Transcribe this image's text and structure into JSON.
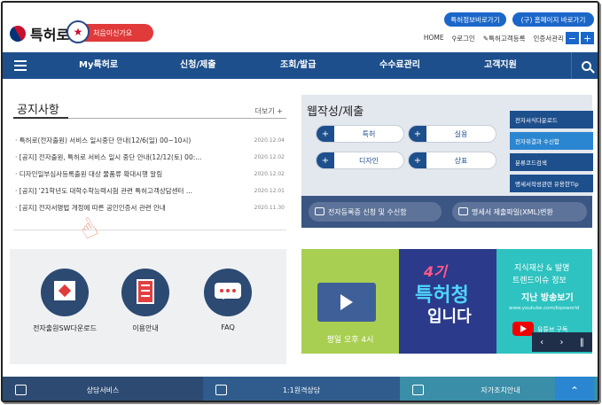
{
  "header": {
    "logo_text": "특허로",
    "first_visit": "처음이신가요",
    "pill_1": "특허정보바로가기",
    "pill_2": "(구) 홈페이지 바로가기",
    "util_links": [
      "HOME",
      "로그인",
      "특허고객등록",
      "인증서관리"
    ],
    "zoom_out": "−",
    "zoom_in": "+"
  },
  "nav": {
    "items": [
      "My특허로",
      "신청/제출",
      "조회/발급",
      "수수료관리",
      "고객지원"
    ]
  },
  "notice": {
    "title": "공지사항",
    "more": "더보기 +",
    "items": [
      {
        "text": "· 특허로(전자출원) 서비스 일시중단 안내(12/6(일) 00~10시)",
        "date": "2020.12.04"
      },
      {
        "text": "· [공지] 전자출원, 특허로 서비스 일시 중단 안내(12/12(토) 00:...",
        "date": "2020.12.02"
      },
      {
        "text": "· 디자인일부심사등록출원 대상 물품류 확대시행 알림",
        "date": "2020.12.02"
      },
      {
        "text": "· [공지] '21학년도 대학수학능력시험 관련 특허고객상담센터 ...",
        "date": "2020.12.01"
      },
      {
        "text": "· [공지] 전자서명법 개정에 따른 공인인증서 관련 안내",
        "date": "2020.11.30"
      }
    ]
  },
  "submit": {
    "title": "웹작성/제출",
    "buttons": [
      "특허",
      "실용",
      "디자인",
      "상표"
    ],
    "plus": "+",
    "side_menu": [
      "전자서식다운로드",
      "전자위결과 수신함",
      "분류코드검색",
      "명세서작성관련 유용한Tip"
    ],
    "bottom": [
      "전자등록증 신청 및 수신함",
      "명세서 제출파일(XML)변환"
    ]
  },
  "quick": {
    "items": [
      "전자출원SW다운로드",
      "이용안내",
      "FAQ"
    ]
  },
  "banners": {
    "b1_caption": "평일 오후 4시",
    "b2_line1": "4기",
    "b2_line2": "특허청",
    "b2_line3": "입니다",
    "b3_line1": "지식재산 & 발명",
    "b3_line2": "트렌드이슈 정보",
    "b3_line3": "지난 방송보기",
    "b3_line4": "www.youtube.com/kipoworld",
    "b3_sub": "유튜브 구독",
    "ctrl": [
      "‹",
      "›",
      "‖"
    ]
  },
  "footer": {
    "items": [
      "상담서비스",
      "1:1원격상담",
      "자가조치안내"
    ],
    "top": "⌃"
  },
  "colors": {
    "nav": "#1d4f8c",
    "accent": "#1b66c9",
    "red": "#e03a3a"
  }
}
